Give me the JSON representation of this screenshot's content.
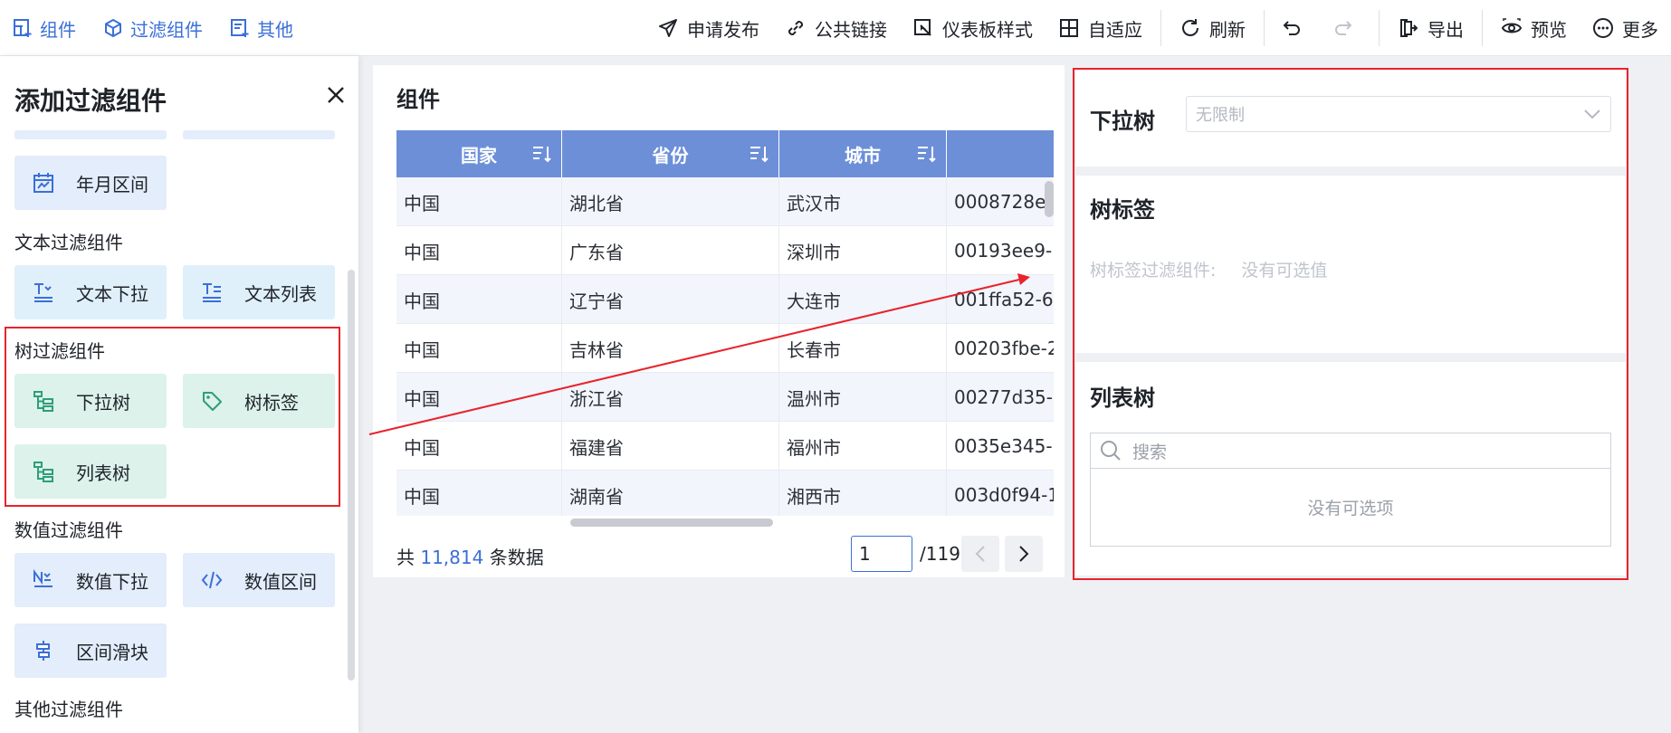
{
  "toolbar": {
    "left": [
      {
        "label": "组件",
        "icon": "add-component-icon"
      },
      {
        "label": "过滤组件",
        "icon": "filter-component-icon"
      },
      {
        "label": "其他",
        "icon": "other-icon"
      }
    ],
    "right": {
      "publish": "申请发布",
      "public_link": "公共链接",
      "dashboard_style": "仪表板样式",
      "adaptive": "自适应",
      "refresh": "刷新",
      "export": "导出",
      "preview": "预览",
      "more": "更多"
    }
  },
  "left_panel": {
    "title": "添加过滤组件",
    "cards": {
      "year_month_range": "年月区间",
      "text_dropdown": "文本下拉",
      "text_list": "文本列表",
      "dropdown_tree": "下拉树",
      "tree_tag": "树标签",
      "list_tree": "列表树",
      "number_dropdown": "数值下拉",
      "number_range": "数值区间",
      "range_slider": "区间滑块"
    },
    "sections": {
      "text": "文本过滤组件",
      "tree": "树过滤组件",
      "number": "数值过滤组件",
      "other": "其他过滤组件"
    }
  },
  "table_widget": {
    "title": "组件",
    "columns": [
      "国家",
      "省份",
      "城市",
      ""
    ],
    "rows": [
      [
        "中国",
        "湖北省",
        "武汉市",
        "0008728e-"
      ],
      [
        "中国",
        "广东省",
        "深圳市",
        "00193ee9-"
      ],
      [
        "中国",
        "辽宁省",
        "大连市",
        "001ffa52-6"
      ],
      [
        "中国",
        "吉林省",
        "长春市",
        "00203fbe-2"
      ],
      [
        "中国",
        "浙江省",
        "温州市",
        "00277d35-"
      ],
      [
        "中国",
        "福建省",
        "福州市",
        "0035e345-"
      ],
      [
        "中国",
        "湖南省",
        "湘西市",
        "003d0f94-1"
      ]
    ],
    "footer": {
      "prefix": "共",
      "count": "11,814",
      "suffix": "条数据"
    },
    "pagination": {
      "current": "1",
      "total": "/119"
    }
  },
  "dropdown_tree_widget": {
    "title": "下拉树",
    "placeholder": "无限制"
  },
  "tree_tag_widget": {
    "title": "树标签",
    "label": "树标签过滤组件:",
    "empty": "没有可选值"
  },
  "list_tree_widget": {
    "title": "列表树",
    "search_placeholder": "搜索",
    "empty": "没有可选项"
  },
  "colors": {
    "accent": "#3b6fd8",
    "header": "#6c8fd8",
    "annotation": "#e8232c"
  }
}
